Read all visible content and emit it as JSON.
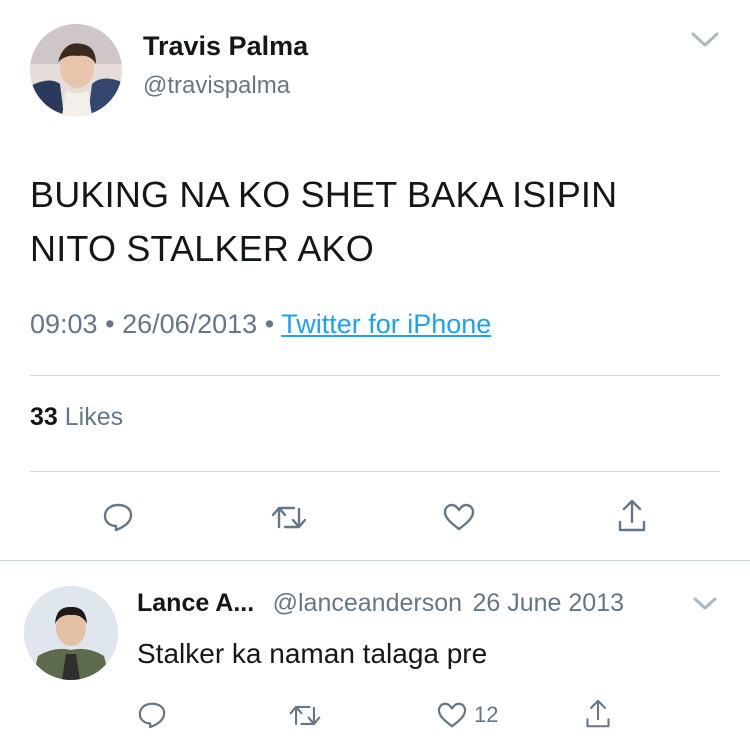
{
  "tweet": {
    "author_name": "Travis Palma",
    "author_handle": "@travispalma",
    "text_line1": "BUKING NA KO SHET BAKA ISIPIN",
    "text_line2": "NITO STALKER AKO",
    "time": "09:03",
    "date": "26/06/2013",
    "source": "Twitter for iPhone",
    "likes_count": "33",
    "likes_label": "Likes"
  },
  "reply": {
    "author_name": "Lance A...",
    "author_handle": "@lanceanderson",
    "date": "26 June 2013",
    "text": "Stalker ka naman talaga pre",
    "like_count": "12"
  },
  "colors": {
    "link": "#1da1f2",
    "secondary_text": "#657786",
    "divider": "#ccd6dd",
    "icon": "#657786"
  },
  "icons": [
    "chevron-down-icon",
    "reply-icon",
    "retweet-icon",
    "heart-icon",
    "share-icon"
  ]
}
